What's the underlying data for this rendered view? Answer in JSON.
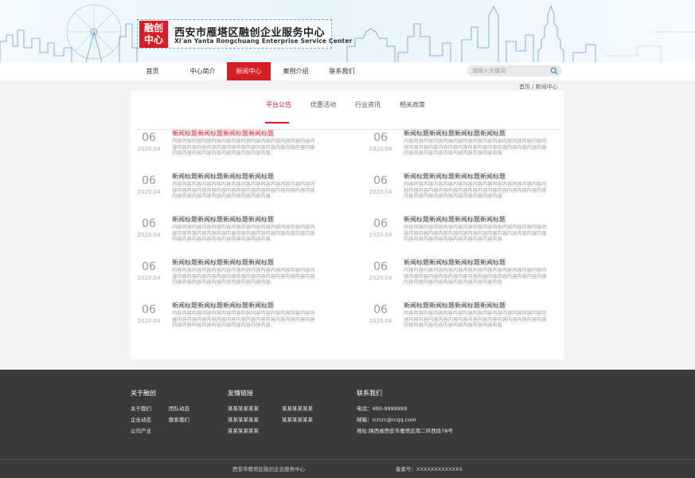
{
  "header": {
    "logo_mark_line1": "融创",
    "logo_mark_line2": "中心",
    "title": "西安市雁塔区融创企业服务中心",
    "subtitle": "Xi'an Yanta Rongchuang Enterprise Service Center"
  },
  "nav": {
    "items": [
      {
        "label": "首页",
        "active": false
      },
      {
        "label": "中心简介",
        "active": false
      },
      {
        "label": "新闻中心",
        "active": true
      },
      {
        "label": "案例介绍",
        "active": false
      },
      {
        "label": "联系我们",
        "active": false
      }
    ],
    "search_placeholder": "请输入关键词"
  },
  "breadcrumb": "首页 / 新闻中心",
  "colors": {
    "accent": "#d81e24",
    "footer_bg": "#3a3a3a"
  },
  "tabs": [
    {
      "label": "平台公告",
      "active": true
    },
    {
      "label": "优惠活动",
      "active": false
    },
    {
      "label": "行业资讯",
      "active": false
    },
    {
      "label": "相关政策",
      "active": false
    }
  ],
  "news": [
    {
      "day": "06",
      "year": "2020.04",
      "title": "新闻标题新闻标题新闻标题新闻标题",
      "highlight": true,
      "body": "内容内容内容内容内容内容内容内容内容内容内容内容内容内容内容内容内容内容内容内容内容内容内容内容内容内容内容内容内容内容内容内容内容内容内容内容内容内容内容."
    },
    {
      "day": "06",
      "year": "2020.04",
      "title": "新闻标题新闻标题新闻标题新闻标题",
      "highlight": false,
      "body": "内容内容内容内容内容内容内容内容内容内容内容内容内容内容内容内容内容内容内容内容内容内容内容内容内容内容内容内容内容内容内容内容内容内容内容内容内容内容内容."
    },
    {
      "day": "06",
      "year": "2020.04",
      "title": "新闻标题新闻标题新闻标题新闻标题",
      "highlight": false,
      "body": "内容内容内容内容内容内容内容内容内容内容内容内容内容内容内容内容内容内容内容内容内容内容内容内容内容内容内容内容内容内容内容内容内容内容内容内容内容内容内容."
    },
    {
      "day": "06",
      "year": "2020.04",
      "title": "新闻标题新闻标题新闻标题新闻标题",
      "highlight": false,
      "body": "内容内容内容内容内容内容内容内容内容内容内容内容内容内容内容内容内容内容内容内容内容内容内容内容内容内容内容内容内容内容内容内容内容内容内容内容内容内容内容."
    },
    {
      "day": "06",
      "year": "2020.04",
      "title": "新闻标题新闻标题新闻标题新闻标题",
      "highlight": false,
      "body": "内容内容内容内容内容内容内容内容内容内容内容内容内容内容内容内容内容内容内容内容内容内容内容内容内容内容内容内容内容内容内容内容内容内容内容内容内容内容内容."
    },
    {
      "day": "06",
      "year": "2020.04",
      "title": "新闻标题新闻标题新闻标题新闻标题",
      "highlight": false,
      "body": "内容内容内容内容内容内容内容内容内容内容内容内容内容内容内容内容内容内容内容内容内容内容内容内容内容内容内容内容内容内容内容内容内容内容内容内容内容内容内容."
    },
    {
      "day": "06",
      "year": "2020.04",
      "title": "新闻标题新闻标题新闻标题新闻标题",
      "highlight": false,
      "body": "内容内容内容内容内容内容内容内容内容内容内容内容内容内容内容内容内容内容内容内容内容内容内容内容内容内容内容内容内容内容内容内容内容内容内容内容内容内容内容."
    },
    {
      "day": "06",
      "year": "2020.04",
      "title": "新闻标题新闻标题新闻标题新闻标题",
      "highlight": false,
      "body": "内容内容内容内容内容内容内容内容内容内容内容内容内容内容内容内容内容内容内容内容内容内容内容内容内容内容内容内容内容内容内容内容内容内容内容内容内容内容内容."
    },
    {
      "day": "06",
      "year": "2020.04",
      "title": "新闻标题新闻标题新闻标题新闻标题",
      "highlight": false,
      "body": "内容内容内容内容内容内容内容内容内容内容内容内容内容内容内容内容内容内容内容内容内容内容内容内容内容内容内容内容内容内容内容内容内容内容内容内容内容内容内容."
    },
    {
      "day": "06",
      "year": "2020.04",
      "title": "新闻标题新闻标题新闻标题新闻标题",
      "highlight": false,
      "body": "内容内容内容内容内容内容内容内容内容内容内容内容内容内容内容内容内容内容内容内容内容内容内容内容内容内容内容内容内容内容内容内容内容内容内容内容内容内容内容."
    }
  ],
  "footer": {
    "about_title": "关于融创",
    "about_links": [
      "关于我们",
      "团队动态",
      "企业动态",
      "联系我们",
      "公司产业"
    ],
    "friends_title": "友情链接",
    "friend_links": [
      "某某某某某某",
      "某某某某某某",
      "某某某某某某",
      "某某某某某某",
      "某某某某某某"
    ],
    "contact_title": "联系我们",
    "phone": "电话：400-9999999",
    "email": "邮箱：rcrcrc@rcqq.com",
    "address": "地址:陕西省西安市雁塔区南二环西段78号",
    "copyright": "西安市雁塔区融创企业服务中心",
    "icp": "备案号：XXXXXXXXXXXXX"
  }
}
